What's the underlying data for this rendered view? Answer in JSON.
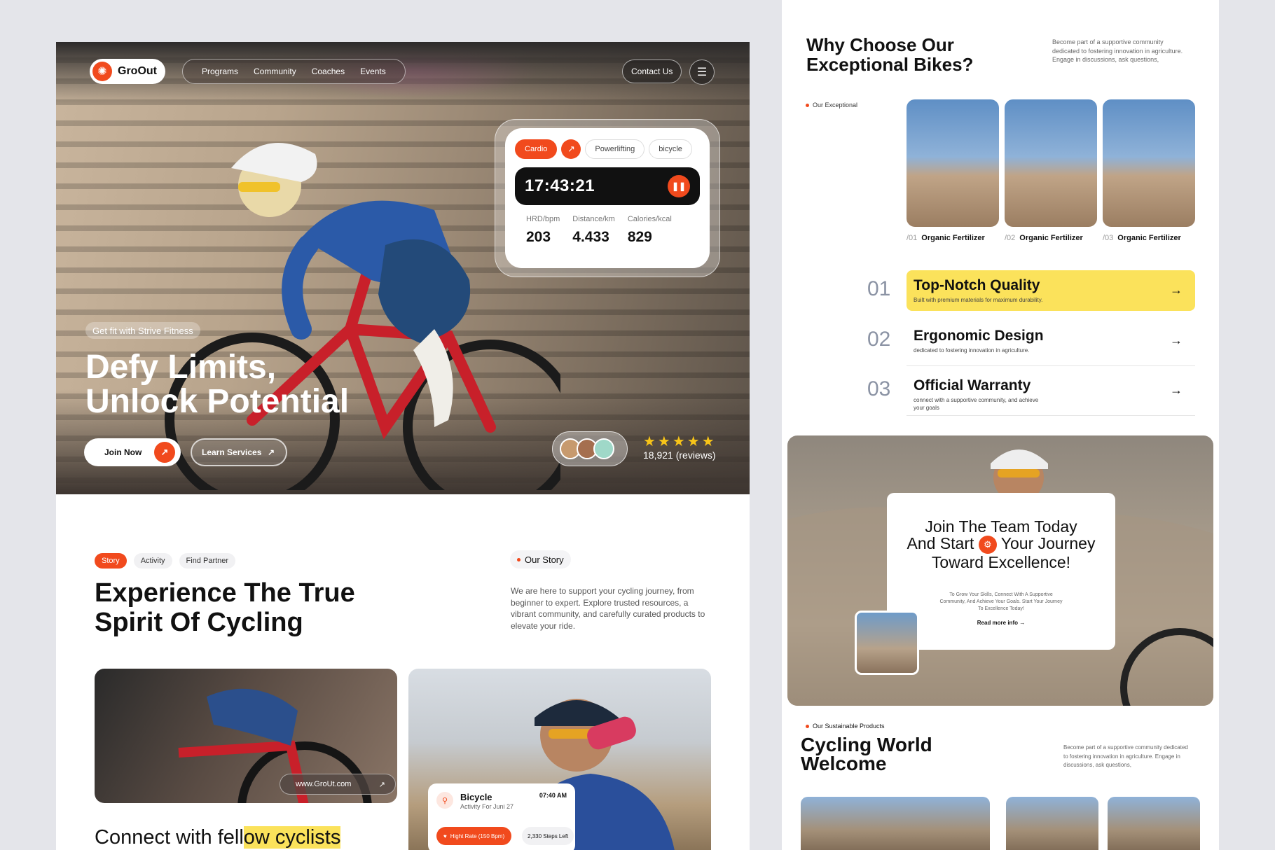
{
  "hero": {
    "logo": "GroOut",
    "nav": [
      "Programs",
      "Community",
      "Coaches",
      "Events"
    ],
    "contact": "Contact Us",
    "tracker": {
      "tabs": [
        "Cardio",
        "Powerlifting",
        "bicycle"
      ],
      "timer": "17:43:21",
      "stats": [
        {
          "label": "HRD/bpm",
          "value": "203"
        },
        {
          "label": "Distance/km",
          "value": "4.433"
        },
        {
          "label": "Calories/kcal",
          "value": "829"
        }
      ]
    },
    "tagline": "Get fit with Strive Fitness",
    "title_line1": "Defy Limits,",
    "title_line2": "Unlock Potential",
    "join": "Join Now",
    "learn": "Learn Services",
    "stars": "★★★★★",
    "reviews": "18,921 (reviews)"
  },
  "story": {
    "tabs": [
      "Story",
      "Activity",
      "Find Partner"
    ],
    "badge": "Our Story",
    "title_line1": "Experience The True",
    "title_line2": "Spirit Of Cycling",
    "desc": "We are here to support your cycling journey, from beginner to expert. Explore trusted resources, a vibrant community, and carefully curated products to elevate your ride.",
    "url": "www.GroUt.com",
    "activity": {
      "title": "Bicycle",
      "sub": "Activity For Juni 27",
      "time": "07:40 AM",
      "heart": "Hight Rate (150 Bpm)",
      "steps": "2,330 Steps Left"
    },
    "connect_plain": "Connect with fell",
    "connect_hl": "ow cyclists"
  },
  "why": {
    "title_line1": "Why Choose Our",
    "title_line2": "Exceptional Bikes?",
    "desc": "Become part of a supportive community dedicated to fostering innovation in agriculture. Engage in discussions, ask questions,",
    "badge": "Our Exceptional",
    "bikes": [
      {
        "num": "/01",
        "label": "Organic Fertilizer"
      },
      {
        "num": "/02",
        "label": "Organic Fertilizer"
      },
      {
        "num": "/03",
        "label": "Organic Fertilizer"
      }
    ],
    "features": [
      {
        "num": "01",
        "title": "Top-Notch Quality",
        "sub": "Built with premium materials for maximum durability."
      },
      {
        "num": "02",
        "title": "Ergonomic Design",
        "sub": "dedicated to fostering innovation in agriculture."
      },
      {
        "num": "03",
        "title": "Official Warranty",
        "sub": "connect with a supportive community, and achieve your goals"
      }
    ]
  },
  "team": {
    "title_a": "Join The Team Today",
    "title_b": "And Start",
    "title_c": "Your Journey",
    "title_d": "Toward Excellence!",
    "desc": "To Grow Your Skills, Connect With A Supportive Community, And Achieve Your Goals. Start Your Journey To Excellence Today!",
    "more": "Read more info →"
  },
  "sustainable": {
    "badge": "Our Sustainable Products",
    "title_line1": "Cycling World",
    "title_line2": "Welcome",
    "desc": "Become part of a supportive community dedicated to fostering innovation in agriculture. Engage in discussions, ask questions,"
  },
  "colors": {
    "accent": "#f14a1d",
    "highlight": "#fbe25b",
    "star": "#f7c419"
  }
}
